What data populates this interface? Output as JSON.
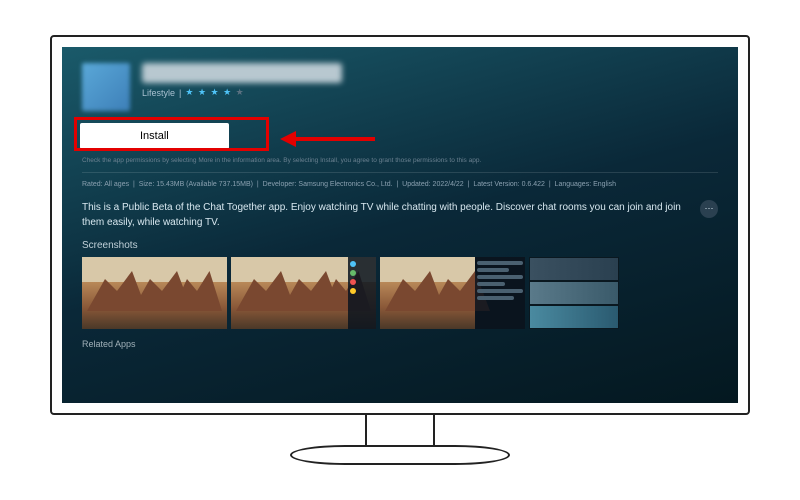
{
  "app": {
    "category": "Lifestyle",
    "rating_stars": 4
  },
  "buttons": {
    "install": "Install"
  },
  "text": {
    "permission_note": "Check the app permissions by selecting More in the information area. By selecting Install, you agree to grant those permissions to this app.",
    "description": "This is a Public Beta of the Chat Together app. Enjoy watching TV while chatting with people. Discover chat rooms you can join and join them easily, while watching TV.",
    "screenshots_label": "Screenshots",
    "related_label": "Related Apps"
  },
  "details": {
    "rated_label": "Rated:",
    "rated_value": "All ages",
    "size_label": "Size:",
    "size_value": "15.43MB (Available 737.15MB)",
    "developer_label": "Developer:",
    "developer_value": "Samsung Electronics Co., Ltd.",
    "updated_label": "Updated:",
    "updated_value": "2022/4/22",
    "version_label": "Latest Version:",
    "version_value": "0.6.422",
    "languages_label": "Languages:",
    "languages_value": "English"
  }
}
